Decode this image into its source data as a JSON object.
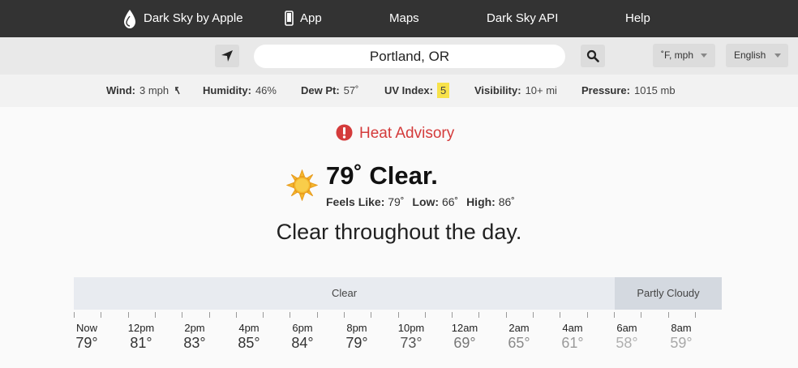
{
  "nav": {
    "logo_label": "Dark Sky by Apple",
    "app_label": "App",
    "maps_label": "Maps",
    "api_label": "Dark Sky API",
    "help_label": "Help"
  },
  "search": {
    "location_value": "Portland, OR",
    "units_label": "˚F, mph",
    "language_label": "English"
  },
  "conditions": {
    "wind": {
      "label": "Wind:",
      "value": "3 mph"
    },
    "humidity": {
      "label": "Humidity:",
      "value": "46%"
    },
    "dew_point": {
      "label": "Dew Pt:",
      "value": "57˚"
    },
    "uv_index": {
      "label": "UV Index:",
      "value": "5"
    },
    "visibility": {
      "label": "Visibility:",
      "value": "10+ mi"
    },
    "pressure": {
      "label": "Pressure:",
      "value": "1015 mb"
    }
  },
  "alert": {
    "label": "Heat Advisory",
    "color": "#d43b3b"
  },
  "current": {
    "headline": "79˚ Clear.",
    "feels_label": "Feels Like:",
    "feels_value": "79˚",
    "low_label": "Low:",
    "low_value": "66˚",
    "high_label": "High:",
    "high_value": "86˚",
    "summary": "Clear throughout the day.",
    "icon": "clear-day-icon"
  },
  "timeline": {
    "segments": [
      {
        "label": "Clear",
        "hours": 20
      },
      {
        "label": "Partly Cloudy",
        "hours": 4
      }
    ],
    "hours": [
      {
        "time": "Now",
        "temp": "79°",
        "color": "#333333"
      },
      {
        "time": "12pm",
        "temp": "81°",
        "color": "#333333"
      },
      {
        "time": "2pm",
        "temp": "83°",
        "color": "#333333"
      },
      {
        "time": "4pm",
        "temp": "85°",
        "color": "#333333"
      },
      {
        "time": "6pm",
        "temp": "84°",
        "color": "#333333"
      },
      {
        "time": "8pm",
        "temp": "79°",
        "color": "#333333"
      },
      {
        "time": "10pm",
        "temp": "73°",
        "color": "#555555"
      },
      {
        "time": "12am",
        "temp": "69°",
        "color": "#777777"
      },
      {
        "time": "2am",
        "temp": "65°",
        "color": "#8a8a8a"
      },
      {
        "time": "4am",
        "temp": "61°",
        "color": "#9a9a9a"
      },
      {
        "time": "6am",
        "temp": "58°",
        "color": "#b0b0b0"
      },
      {
        "time": "8am",
        "temp": "59°",
        "color": "#a8a8a8"
      }
    ]
  },
  "colors": {
    "nav_bg": "#333333",
    "uv_badge": "#f7e24a",
    "sun": "#f5b82e"
  }
}
